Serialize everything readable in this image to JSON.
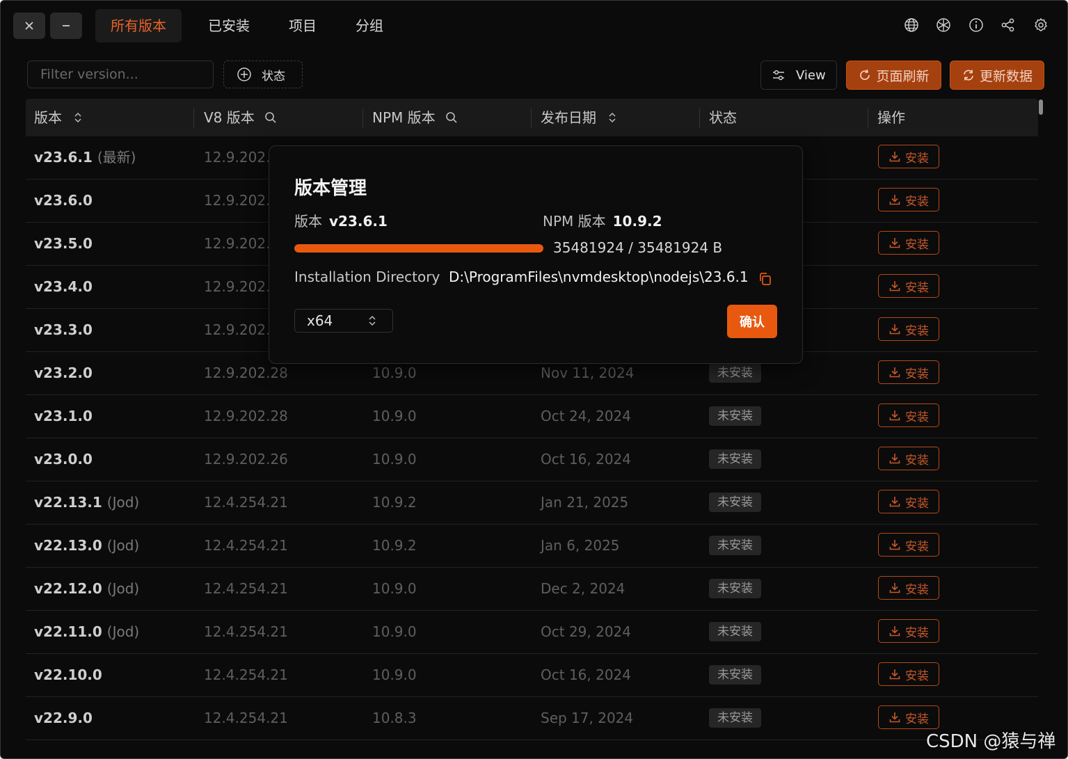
{
  "window": {
    "close_icon": "close-icon",
    "minimize_icon": "minimize-icon"
  },
  "tabs": [
    {
      "label": "所有版本",
      "active": true
    },
    {
      "label": "已安装",
      "active": false
    },
    {
      "label": "项目",
      "active": false
    },
    {
      "label": "分组",
      "active": false
    }
  ],
  "toolbar_icons": [
    "globe-icon",
    "snowflake-icon",
    "info-icon",
    "share-icon",
    "gear-icon"
  ],
  "filter": {
    "placeholder": "Filter version..."
  },
  "status_filter": {
    "label": "状态"
  },
  "view_button": {
    "label": "View"
  },
  "refresh_button": {
    "label": "页面刷新"
  },
  "update_button": {
    "label": "更新数据"
  },
  "table": {
    "headers": [
      "版本",
      "V8 版本",
      "NPM 版本",
      "发布日期",
      "状态",
      "操作"
    ],
    "install_label": "安装",
    "rows": [
      {
        "version": "v23.6.1",
        "tag": "(最新)",
        "v8": "12.9.202.2",
        "npm": "",
        "date": "",
        "status": ""
      },
      {
        "version": "v23.6.0",
        "tag": "",
        "v8": "12.9.202.2",
        "npm": "",
        "date": "",
        "status": ""
      },
      {
        "version": "v23.5.0",
        "tag": "",
        "v8": "12.9.202.2",
        "npm": "",
        "date": "",
        "status": ""
      },
      {
        "version": "v23.4.0",
        "tag": "",
        "v8": "12.9.202.2",
        "npm": "",
        "date": "",
        "status": ""
      },
      {
        "version": "v23.3.0",
        "tag": "",
        "v8": "12.9.202.2",
        "npm": "",
        "date": "",
        "status": ""
      },
      {
        "version": "v23.2.0",
        "tag": "",
        "v8": "12.9.202.28",
        "npm": "10.9.0",
        "date": "Nov 11, 2024",
        "status": "未安装"
      },
      {
        "version": "v23.1.0",
        "tag": "",
        "v8": "12.9.202.28",
        "npm": "10.9.0",
        "date": "Oct 24, 2024",
        "status": "未安装"
      },
      {
        "version": "v23.0.0",
        "tag": "",
        "v8": "12.9.202.26",
        "npm": "10.9.0",
        "date": "Oct 16, 2024",
        "status": "未安装"
      },
      {
        "version": "v22.13.1",
        "tag": "(Jod)",
        "v8": "12.4.254.21",
        "npm": "10.9.2",
        "date": "Jan 21, 2025",
        "status": "未安装"
      },
      {
        "version": "v22.13.0",
        "tag": "(Jod)",
        "v8": "12.4.254.21",
        "npm": "10.9.2",
        "date": "Jan 6, 2025",
        "status": "未安装"
      },
      {
        "version": "v22.12.0",
        "tag": "(Jod)",
        "v8": "12.4.254.21",
        "npm": "10.9.0",
        "date": "Dec 2, 2024",
        "status": "未安装"
      },
      {
        "version": "v22.11.0",
        "tag": "(Jod)",
        "v8": "12.4.254.21",
        "npm": "10.9.0",
        "date": "Oct 29, 2024",
        "status": "未安装"
      },
      {
        "version": "v22.10.0",
        "tag": "",
        "v8": "12.4.254.21",
        "npm": "10.9.0",
        "date": "Oct 16, 2024",
        "status": "未安装"
      },
      {
        "version": "v22.9.0",
        "tag": "",
        "v8": "12.4.254.21",
        "npm": "10.8.3",
        "date": "Sep 17, 2024",
        "status": "未安装"
      }
    ]
  },
  "modal": {
    "title": "版本管理",
    "version_label": "版本",
    "version_value": "v23.6.1",
    "npm_label": "NPM 版本",
    "npm_value": "10.9.2",
    "progress_fraction": 1.0,
    "progress_text": "35481924 / 35481924 B",
    "dir_label": "Installation Directory",
    "dir_value": "D:\\ProgramFiles\\nvmdesktop\\nodejs\\23.6.1",
    "arch_value": "x64",
    "confirm_label": "确认"
  },
  "watermark": "CSDN @猿与禅",
  "colors": {
    "accent": "#e8590f",
    "background": "#0b0b0b"
  }
}
